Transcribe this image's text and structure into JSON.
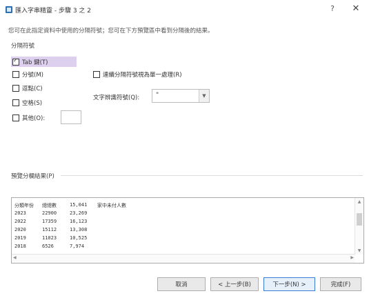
{
  "window": {
    "title": "匯入字串精靈 - 步驟 3 之 2",
    "help": "?",
    "close": "✕",
    "app_icon": "excel-window-icon"
  },
  "instruction": "您可在此指定資料中使用的分隔符號；您可在下方預覽區中看到分隔後的結果。",
  "delimiters": {
    "group_label": "分隔符號",
    "tab": {
      "label": "Tab 鍵(T)",
      "checked": true
    },
    "semicolon": {
      "label": "分號(M)",
      "checked": false
    },
    "comma": {
      "label": "逗點(C)",
      "checked": false
    },
    "space": {
      "label": "空格(S)",
      "checked": false
    },
    "other": {
      "label": "其他(O):",
      "checked": false,
      "value": ""
    }
  },
  "consecutive": {
    "label": "連續分隔符號視為單一處理(R)",
    "checked": false
  },
  "text_qualifier": {
    "label": "文字辨識符號(Q):",
    "value": "\""
  },
  "preview": {
    "label": "預覽分欄結果(P)",
    "rows": [
      [
        "分類年份",
        "總總數",
        "15,041",
        "家中未付人數"
      ],
      [
        "2023",
        "22900",
        "23,269",
        ""
      ],
      [
        "2022",
        "17359",
        "16,123",
        ""
      ],
      [
        "2020",
        "15112",
        "13,308",
        ""
      ],
      [
        "2019",
        "11023",
        "10,525",
        ""
      ],
      [
        "2018",
        "6526",
        "7,974",
        ""
      ]
    ]
  },
  "buttons": {
    "cancel": "取消",
    "back": "< 上一步(B)",
    "next": "下一步(N) >",
    "finish": "完成(F)"
  }
}
